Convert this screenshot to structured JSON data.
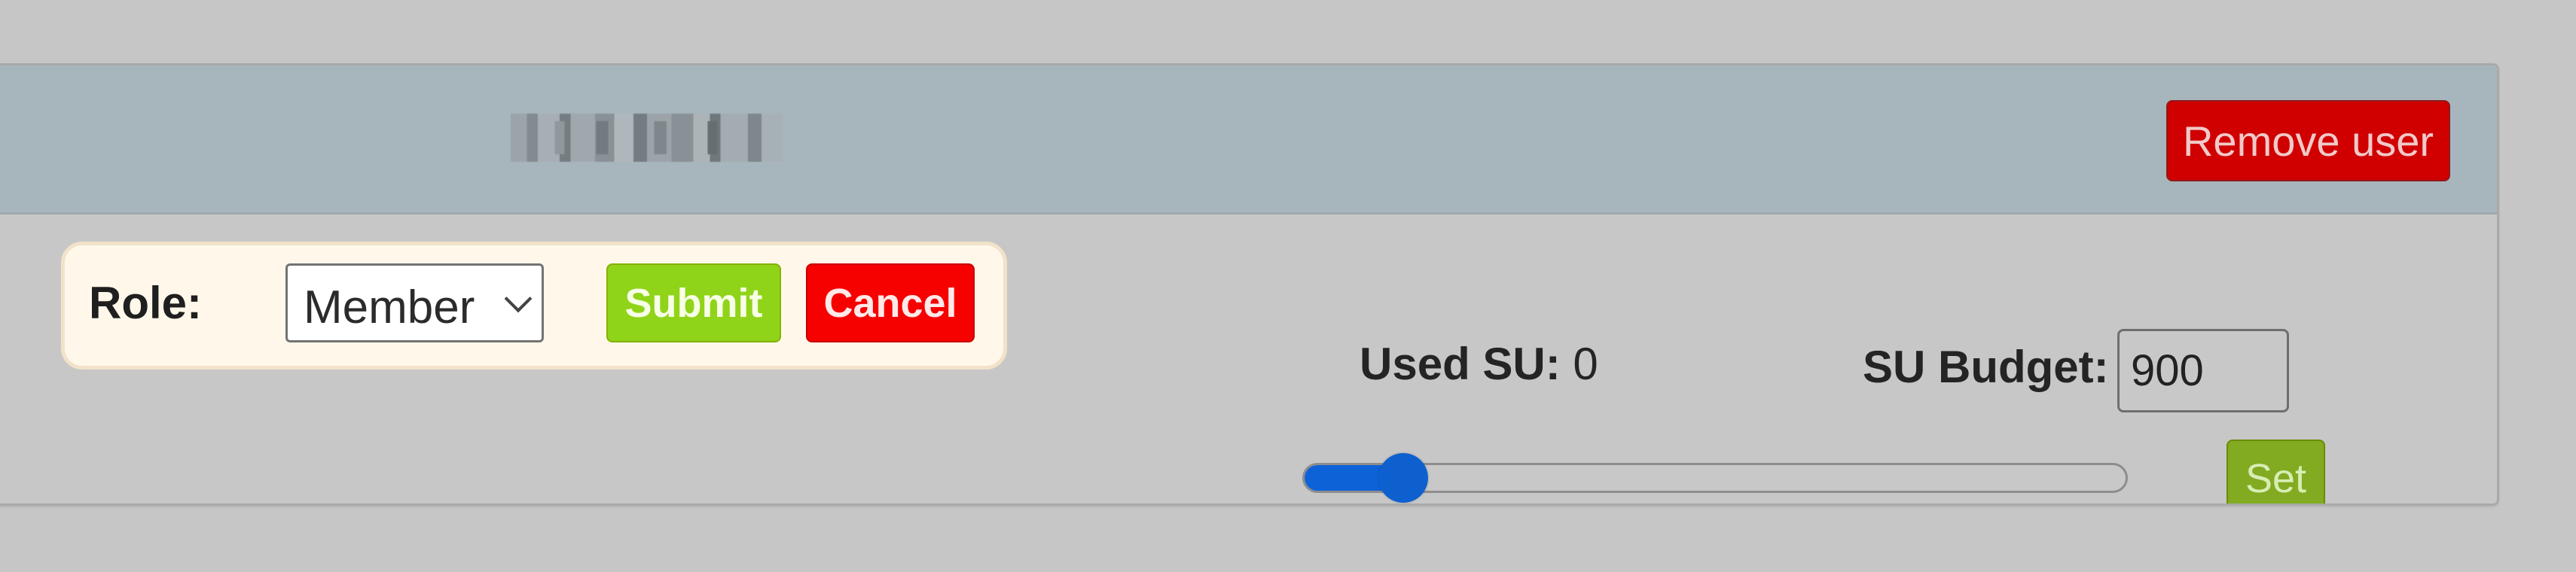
{
  "header": {
    "user_name_redacted": "",
    "remove_user_label": "Remove user"
  },
  "role_form": {
    "role_label": "Role:",
    "selected_role": "Member",
    "submit_label": "Submit",
    "cancel_label": "Cancel"
  },
  "su_panel": {
    "used_su_label": "Used SU:",
    "used_su_value": "0",
    "su_budget_label": "SU Budget:",
    "su_budget_value": "900",
    "slider_fraction": 0.12,
    "set_label": "Set"
  },
  "colors": {
    "background": "#c6c6c6",
    "header": "#a7b6bd",
    "danger": "#d00000",
    "submit_green": "#90d41a",
    "cancel_red": "#f60000",
    "slider_blue": "#0d62d8",
    "set_green": "#82ab21"
  }
}
